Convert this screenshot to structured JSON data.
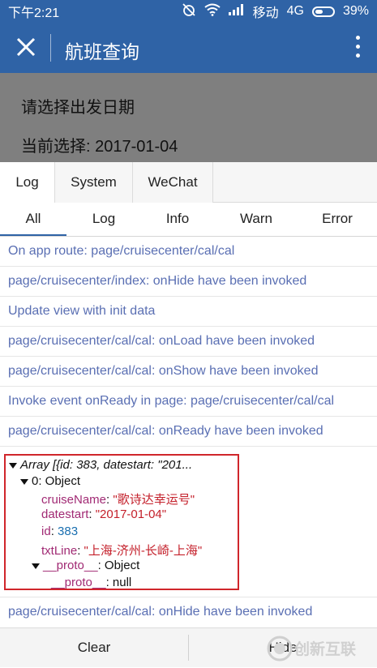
{
  "status_bar": {
    "time": "下午2:21",
    "carrier": "移动",
    "network": "4G",
    "battery": "39%"
  },
  "app_bar": {
    "title": "航班查询"
  },
  "page": {
    "prompt": "请选择出发日期",
    "current": "当前选择: 2017-01-04"
  },
  "console_tabs": [
    "Log",
    "System",
    "WeChat"
  ],
  "filter_tabs": [
    "All",
    "Log",
    "Info",
    "Warn",
    "Error"
  ],
  "logs": [
    "On app route: page/cruisecenter/cal/cal",
    "page/cruisecenter/index: onHide have been invoked",
    "Update view with init data",
    "page/cruisecenter/cal/cal: onLoad have been invoked",
    "page/cruisecenter/cal/cal: onShow have been invoked",
    "Invoke event onReady in page: page/cruisecenter/cal/cal",
    "page/cruisecenter/cal/cal: onReady have been invoked"
  ],
  "object_view": {
    "header": "Array [{id: 383, datestart: \"201...",
    "item_label": "0: Object",
    "fields": {
      "cruiseName_key": "cruiseName",
      "cruiseName_val": "\"歌诗达幸运号\"",
      "datestart_key": "datestart",
      "datestart_val": "\"2017-01-04\"",
      "id_key": "id",
      "id_val": "383",
      "txtLine_key": "txtLine",
      "txtLine_val": "\"上海-济州-长崎-上海\""
    },
    "proto_key": "__proto__",
    "proto_val": "Object",
    "proto_inner_key": "__proto__",
    "proto_inner_val": "null"
  },
  "last_log": "page/cruisecenter/cal/cal: onHide have been invoked",
  "footer": {
    "clear": "Clear",
    "hide": "Hide"
  },
  "watermark": "创新互联",
  "colors": {
    "primary": "#2f63a6",
    "log_text": "#5a6fb3",
    "highlight_border": "#d0262b"
  }
}
